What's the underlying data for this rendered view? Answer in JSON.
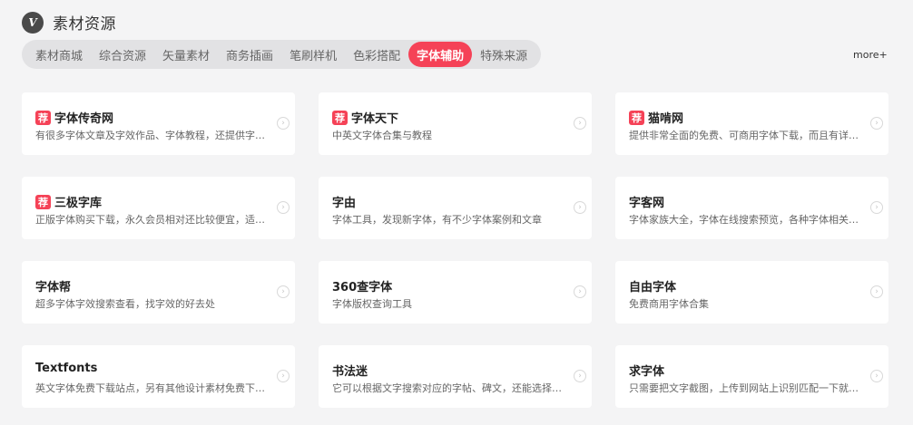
{
  "header": {
    "logo": "V",
    "title": "素材资源"
  },
  "tabs": [
    {
      "label": "素材商城",
      "active": false
    },
    {
      "label": "综合资源",
      "active": false
    },
    {
      "label": "矢量素材",
      "active": false
    },
    {
      "label": "商务插画",
      "active": false
    },
    {
      "label": "笔刷样机",
      "active": false
    },
    {
      "label": "色彩搭配",
      "active": false
    },
    {
      "label": "字体辅助",
      "active": true
    },
    {
      "label": "特殊来源",
      "active": false
    }
  ],
  "more_label": "more+",
  "badge_label": "荐",
  "arrow_icon": "chevron-right-circle-icon",
  "accent_color": "#f54257",
  "cards": [
    {
      "title": "字体传奇网",
      "recommended": true,
      "desc": "有很多字体文章及字效作品、字体教程，还提供字体设计服务"
    },
    {
      "title": "字体天下",
      "recommended": true,
      "desc": "中英文字体合集与教程"
    },
    {
      "title": "猫啃网",
      "recommended": true,
      "desc": "提供非常全面的免费、可商用字体下载，而且有详细的字体介绍"
    },
    {
      "title": "三极字库",
      "recommended": true,
      "desc": "正版字体购买下载，永久会员相对还比较便宜，适合长期使用"
    },
    {
      "title": "字由",
      "recommended": false,
      "desc": "字体工具，发现新字体，有不少字体案例和文章"
    },
    {
      "title": "字客网",
      "recommended": false,
      "desc": "字体家族大全，字体在线搜索预览，各种字体相关的下载资源"
    },
    {
      "title": "字体帮",
      "recommended": false,
      "desc": "超多字体字效搜索查看，找字效的好去处"
    },
    {
      "title": "360查字体",
      "recommended": false,
      "desc": "字体版权查询工具"
    },
    {
      "title": "自由字体",
      "recommended": false,
      "desc": "免费商用字体合集"
    },
    {
      "title": "Textfonts",
      "recommended": false,
      "desc": "英文字体免费下载站点，另有其他设计素材免费下载资源"
    },
    {
      "title": "书法迷",
      "recommended": false,
      "desc": "它可以根据文字搜索对应的字帖、碑文，还能选择书法家风格"
    },
    {
      "title": "求字体",
      "recommended": false,
      "desc": "只需要把文字截图，上传到网站上识别匹配一下就能找到字体"
    }
  ]
}
